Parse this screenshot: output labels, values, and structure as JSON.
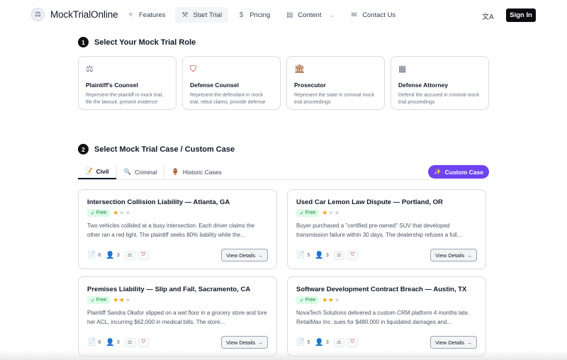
{
  "header": {
    "brand": "MockTrialOnline",
    "nav": [
      {
        "label": "Features",
        "icon": "sparkle-icon"
      },
      {
        "label": "Start Trial",
        "icon": "gavel-icon"
      },
      {
        "label": "Pricing",
        "icon": "dollar-icon"
      },
      {
        "label": "Content",
        "icon": "document-icon"
      },
      {
        "label": "Contact Us",
        "icon": "mail-icon"
      }
    ],
    "signin_label": "Sign In"
  },
  "role_section": {
    "step": "1",
    "title": "Select Your Mock Trial Role",
    "roles": [
      {
        "title": "Plaintiff's Counsel",
        "desc": "Represent the plaintiff in mock trial, file the lawsuit, present evidence",
        "icon": "scales-icon"
      },
      {
        "title": "Defense Counsel",
        "desc": "Represent the defendant in mock trial, rebut claims, provide defense",
        "icon": "shield-icon"
      },
      {
        "title": "Prosecutor",
        "desc": "Represent the state in criminal mock trial proceedings",
        "icon": "courthouse-icon"
      },
      {
        "title": "Defense Attorney",
        "desc": "Defend the accused in criminal mock trial proceedings",
        "icon": "calendar-icon"
      }
    ]
  },
  "case_section": {
    "step": "2",
    "title": "Select Mock Trial Case / Custom Case",
    "tabs": [
      {
        "label": "Civil",
        "icon": "memo-icon"
      },
      {
        "label": "Criminal",
        "icon": "magnifier-icon"
      },
      {
        "label": "Historic Cases",
        "icon": "vase-icon"
      }
    ],
    "custom_label": "Custom Case",
    "cases": [
      {
        "title": "Intersection Collision Liability — Atlanta, GA",
        "badge": "Free",
        "rating": 1,
        "desc": "Two vehicles collided at a busy intersection. Each driver claims the other ran a red light. The plaintiff seeks 80% liability while the...",
        "docs": "6",
        "people": "3",
        "details_label": "View Details"
      },
      {
        "title": "Used Car Lemon Law Dispute — Portland, OR",
        "badge": "Free",
        "rating": 1,
        "desc": "Buyer purchased a \"certified pre-owned\" SUV that developed transmission failure within 30 days. The dealership refuses a full...",
        "docs": "5",
        "people": "3",
        "details_label": "View Details"
      },
      {
        "title": "Premises Liability — Slip and Fall, Sacramento, CA",
        "badge": "Free",
        "rating": 2,
        "desc": "Plaintiff Sandra Okafor slipped on a wet floor in a grocery store and tore her ACL, incurring $62,000 in medical bills. The store...",
        "docs": "6",
        "people": "3",
        "details_label": "View Details"
      },
      {
        "title": "Software Development Contract Breach — Austin, TX",
        "badge": "Free",
        "rating": 2,
        "desc": "NovaTech Solutions delivered a custom CRM platform 4 months late. RetailMax Inc. sues for $480,000 in liquidated damages and...",
        "docs": "5",
        "people": "3",
        "details_label": "View Details"
      }
    ]
  },
  "colors": {
    "accent": "#6d43f2",
    "free_badge_bg": "#dcfce7",
    "free_badge_text": "#15803d",
    "star": "#f59e0b"
  }
}
